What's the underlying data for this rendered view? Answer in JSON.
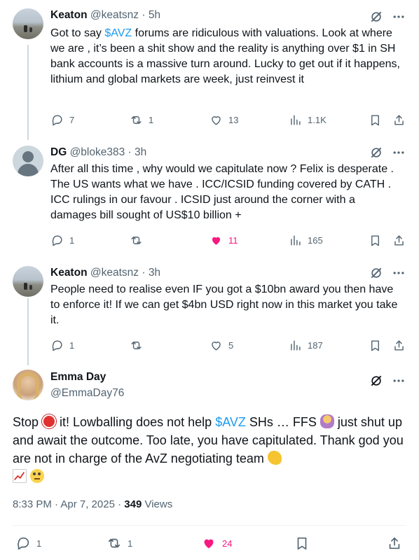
{
  "replies": [
    {
      "name": "Keaton",
      "handle": "@keatsnz",
      "dot": "·",
      "time": "5h",
      "text_line1_pre": "Got to say ",
      "text_line1_link": "$AVZ",
      "text_line1_post": " forums are ridiculous with valuations. Look at",
      "text_rest": "where we are , it’s been a shit show and the reality is anything over $1 in SH bank accounts is a massive turn around. Lucky to get out if it happens, lithium and global markets are week, just reinvest it",
      "replies": "7",
      "reposts": "1",
      "likes": "13",
      "views": "1.1K"
    },
    {
      "name": "DG",
      "handle": "@bloke383",
      "dot": "·",
      "time": "3h",
      "text": "After all this time , why would we capitulate now ? Felix is desperate . The US wants what we have . ICC/ICSID funding covered by CATH . ICC rulings in our favour . ICSID just around the corner with a damages bill sought of US$10 billion +",
      "replies": "1",
      "reposts": "",
      "likes": "11",
      "views": "165"
    },
    {
      "name": "Keaton",
      "handle": "@keatsnz",
      "dot": "·",
      "time": "3h",
      "text": "People need to realise even IF you got a $10bn award you then have to enforce it! If we can get $4bn USD right now in this market you take it.",
      "replies": "1",
      "reposts": "",
      "likes": "5",
      "views": "187"
    }
  ],
  "main": {
    "name": "Emma Day",
    "handle": "@EmmaDay76",
    "text_a": "Stop ",
    "text_b": " it! Lowballing does not help ",
    "text_link": "$AVZ",
    "text_c": " SHs  … FFS ",
    "text_d": " just shut up and await the outcome. Too late, you have capitulated. Thank god you are not in charge of the AvZ negotiating team ",
    "timestamp": "8:33 PM · Apr 7, 2025 · ",
    "views_count": "349",
    "views_label": " Views",
    "replies": "1",
    "reposts": "1",
    "likes": "24"
  },
  "icons": [
    "reply-icon",
    "repost-icon",
    "like-icon",
    "views-icon",
    "bookmark-icon",
    "share-icon",
    "grok-icon",
    "more-icon"
  ],
  "colors": {
    "accent": "#1d9bf0",
    "like": "#f91880",
    "muted": "#536471"
  }
}
